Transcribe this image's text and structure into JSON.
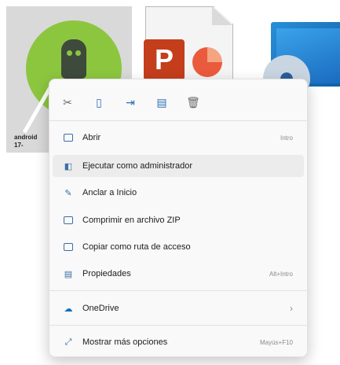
{
  "desktop": {
    "icons": [
      {
        "name": "android-studio",
        "label": "android\n17-"
      },
      {
        "name": "powerpoint-file",
        "label": ""
      },
      {
        "name": "setup-file",
        "label": ""
      }
    ]
  },
  "context_menu": {
    "quick_actions": [
      {
        "name": "cut",
        "icon": "scissors-icon"
      },
      {
        "name": "copy",
        "icon": "copy-icon"
      },
      {
        "name": "share",
        "icon": "share-icon"
      },
      {
        "name": "rename",
        "icon": "rename-icon"
      },
      {
        "name": "delete",
        "icon": "trash-icon"
      }
    ],
    "items": [
      {
        "label": "Abrir",
        "shortcut": "Intro"
      },
      {
        "label": "Ejecutar como administrador",
        "shortcut": ""
      },
      {
        "label": "Anclar a Inicio",
        "shortcut": ""
      },
      {
        "label": "Comprimir en archivo ZIP",
        "shortcut": ""
      },
      {
        "label": "Copiar como ruta de acceso",
        "shortcut": ""
      },
      {
        "label": "Propiedades",
        "shortcut": "Alt+Intro"
      },
      {
        "label": "OneDrive",
        "shortcut": "›"
      },
      {
        "label": "Mostrar más opciones",
        "shortcut": "Mayús+F10"
      }
    ]
  },
  "colors": {
    "accent": "#2b6fb6",
    "android_green": "#8cc63f",
    "powerpoint_red": "#c43e1c"
  }
}
